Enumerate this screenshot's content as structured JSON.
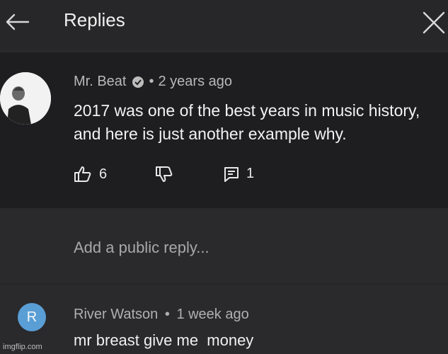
{
  "header": {
    "title": "Replies",
    "back_icon": "arrow-left-icon",
    "close_icon": "close-icon"
  },
  "comment": {
    "author": "Mr. Beat",
    "verified_icon": "verified-check-icon",
    "separator": "•",
    "time": "2 years ago",
    "text": "2017 was one of the best years in music history, and here is just another example why.",
    "likes": "6",
    "replies": "1",
    "like_icon": "thumbs-up-icon",
    "dislike_icon": "thumbs-down-icon",
    "reply_icon": "comment-icon"
  },
  "reply_input": {
    "placeholder": "Add a public reply..."
  },
  "reply": {
    "avatar_letter": "R",
    "author": "River Watson",
    "separator": "•",
    "time": "1 week ago",
    "text": "mr breast give me  money"
  },
  "watermark": "imgflip.com",
  "colors": {
    "avatar_reply": "#5a9ed6",
    "panel": "#1e1e20",
    "background": "#2a2a2c"
  }
}
